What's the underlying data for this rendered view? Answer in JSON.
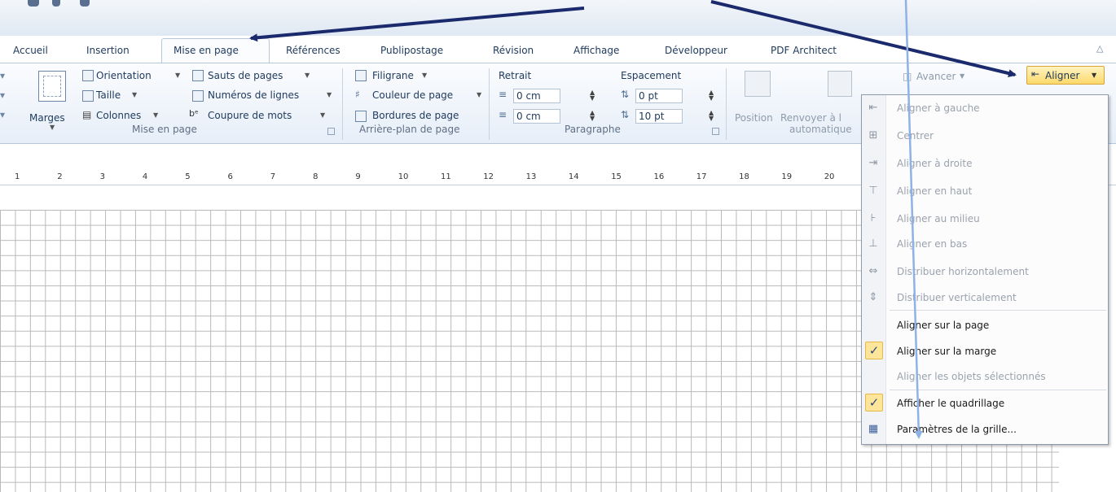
{
  "tabs": [
    {
      "label": "Accueil"
    },
    {
      "label": "Insertion"
    },
    {
      "label": "Mise en page"
    },
    {
      "label": "Références"
    },
    {
      "label": "Publipostage"
    },
    {
      "label": "Révision"
    },
    {
      "label": "Affichage"
    },
    {
      "label": "Développeur"
    },
    {
      "label": "PDF Architect"
    }
  ],
  "page_setup": {
    "marges": "Marges",
    "orientation": "Orientation",
    "taille": "Taille",
    "colonnes": "Colonnes",
    "sauts": "Sauts de pages",
    "numeros": "Numéros de lignes",
    "coupure": "Coupure de mots",
    "group_label": "Mise en page"
  },
  "background": {
    "filigrane": "Filigrane",
    "couleur": "Couleur de page",
    "bordures": "Bordures de page",
    "group_label": "Arrière-plan de page"
  },
  "paragraph": {
    "retrait": "Retrait",
    "espacement": "Espacement",
    "indent_left": "0 cm",
    "indent_right": "0 cm",
    "space_before": "0 pt",
    "space_after": "10 pt",
    "group_label": "Paragraphe"
  },
  "arrange": {
    "position": "Position",
    "renvoyer_line1": "Renvoyer à l",
    "renvoyer_line2": "automatique",
    "avancer": "Avancer",
    "aligner": "Aligner"
  },
  "ruler": {
    "numbers": [
      "1",
      "2",
      "3",
      "4",
      "5",
      "6",
      "7",
      "8",
      "9",
      "10",
      "11",
      "12",
      "13",
      "14",
      "15",
      "16",
      "17",
      "18",
      "19",
      "20"
    ]
  },
  "align_menu": {
    "items": [
      {
        "label": "Aligner à gauche",
        "enabled": false
      },
      {
        "label": "Centrer",
        "enabled": false
      },
      {
        "label": "Aligner à droite",
        "enabled": false
      },
      {
        "label": "Aligner en haut",
        "enabled": false
      },
      {
        "label": "Aligner au milieu",
        "enabled": false
      },
      {
        "label": "Aligner en bas",
        "enabled": false
      },
      {
        "label": "Distribuer horizontalement",
        "enabled": false
      },
      {
        "label": "Distribuer verticalement",
        "enabled": false
      },
      {
        "label": "Aligner sur la page",
        "enabled": true
      },
      {
        "label": "Aligner sur la marge",
        "enabled": true,
        "checked": true
      },
      {
        "label": "Aligner les objets sélectionnés",
        "enabled": false
      },
      {
        "label": "Afficher le quadrillage",
        "enabled": true,
        "checked": true
      },
      {
        "label": "Paramètres de la grille...",
        "enabled": true
      }
    ]
  },
  "colors": {
    "annotation_arrow": "#1a2a6c",
    "annotation_arrow_light": "#8fb2e6",
    "highlight": "#fbd96b"
  }
}
